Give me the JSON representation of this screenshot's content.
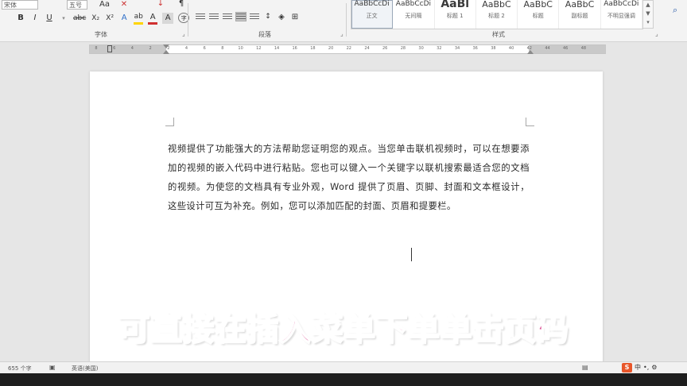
{
  "ribbon": {
    "font_name_value": "宋体",
    "font_size_value": "五号",
    "groups": {
      "font": "字体",
      "paragraph": "段落",
      "styles": "样式"
    },
    "styles": [
      {
        "preview": "AaBbCcDi",
        "name": "正文"
      },
      {
        "preview": "AaBbCcDi",
        "name": "无间隔"
      },
      {
        "preview": "AaBl",
        "name": "标题 1"
      },
      {
        "preview": "AaBbC",
        "name": "标题 2"
      },
      {
        "preview": "AaBbC",
        "name": "标题"
      },
      {
        "preview": "AaBbC",
        "name": "副标题"
      },
      {
        "preview": "AaBbCcDi",
        "name": "不明显强调"
      }
    ],
    "tools": {
      "bold": "B",
      "italic": "I",
      "underline": "U",
      "strikethrough": "abc",
      "subscript": "X₂",
      "superscript": "X²",
      "text_effects": "A",
      "highlight": "ab",
      "font_color": "A",
      "char_shading": "A",
      "enclosed": "字"
    }
  },
  "ruler": {
    "ticks": [
      "8",
      "6",
      "4",
      "2",
      "2",
      "4",
      "6",
      "8",
      "10",
      "12",
      "14",
      "16",
      "18",
      "20",
      "22",
      "24",
      "26",
      "28",
      "30",
      "32",
      "34",
      "36",
      "38",
      "40",
      "42",
      "44",
      "46",
      "48"
    ]
  },
  "document": {
    "paragraph": "视频提供了功能强大的方法帮助您证明您的观点。当您单击联机视频时，可以在想要添加的视频的嵌入代码中进行粘贴。您也可以键入一个关键字以联机搜索最适合您的文档的视频。为使您的文档具有专业外观，Word 提供了页眉、页脚、封面和文本框设计，这些设计可互为补充。例如，您可以添加匹配的封面、页眉和提要栏。"
  },
  "subtitle": "可直接在插入菜单下单单击页码",
  "status": {
    "word_count": "655 个字",
    "language": "英语(美国)"
  },
  "ime": {
    "logo": "S",
    "mode": "中"
  },
  "colors": {
    "subtitle": "#d63a86",
    "highlight": "#ffd400",
    "font_color": "#d03030",
    "ime_logo": "#e8562a"
  }
}
